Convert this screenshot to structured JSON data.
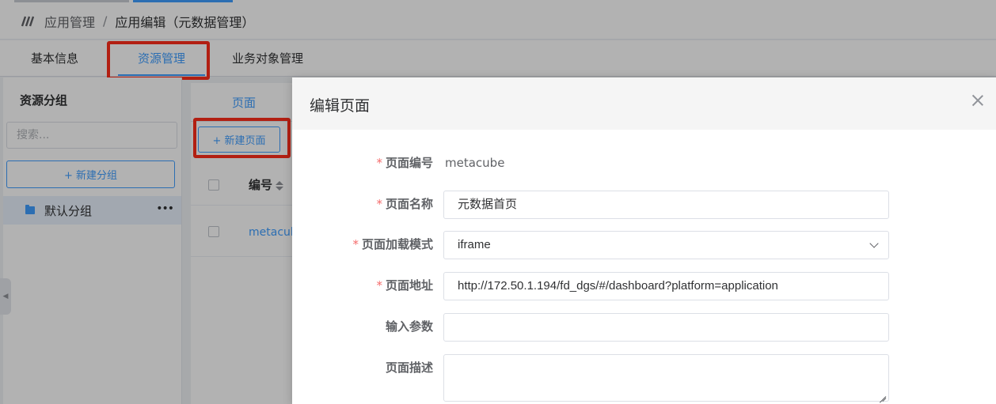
{
  "breadcrumb": {
    "parent": "应用管理",
    "separator": "/",
    "current": "应用编辑（元数据管理）"
  },
  "tabs": [
    {
      "label": "基本信息"
    },
    {
      "label": "资源管理"
    },
    {
      "label": "业务对象管理"
    }
  ],
  "sidebar": {
    "title": "资源分组",
    "search_placeholder": "搜索...",
    "new_group_label": "+ 新建分组",
    "groups": [
      {
        "label": "默认分组",
        "more": "•••"
      }
    ]
  },
  "main": {
    "tab_label": "页面",
    "new_page_label": "+ 新建页面",
    "columns": [
      "编号"
    ],
    "rows": [
      {
        "code": "metacube"
      }
    ]
  },
  "dialog": {
    "title": "编辑页面",
    "required_mark": "*",
    "fields": {
      "code": {
        "label": "页面编号",
        "value": "metacube"
      },
      "name": {
        "label": "页面名称",
        "value": "元数据首页"
      },
      "load_mode": {
        "label": "页面加载模式",
        "value": "iframe"
      },
      "url": {
        "label": "页面地址",
        "value": "http://172.50.1.194/fd_dgs/#/dashboard?platform=application"
      },
      "params": {
        "label": "输入参数",
        "value": ""
      },
      "description": {
        "label": "页面描述",
        "value": ""
      }
    }
  },
  "colors": {
    "accent": "#409eff",
    "highlight": "#ff2d1a",
    "required": "#f56c6c"
  }
}
